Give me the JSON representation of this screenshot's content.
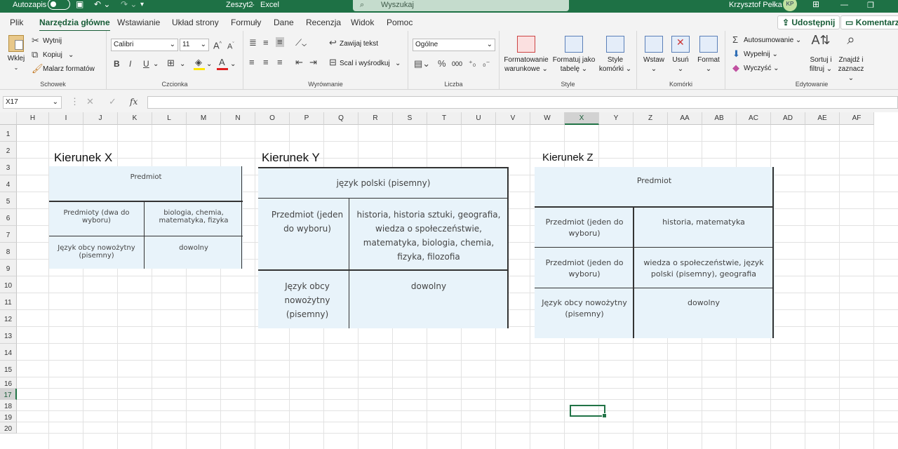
{
  "titlebar": {
    "autosave_label": "Autozapis",
    "filename": "Zeszyt2",
    "app": "Excel",
    "search_placeholder": "Wyszukaj",
    "user_name": "Krzysztof Pełka",
    "user_initials": "KP"
  },
  "tabs": [
    "Plik",
    "Narzędzia główne",
    "Wstawianie",
    "Układ strony",
    "Formuły",
    "Dane",
    "Recenzja",
    "Widok",
    "Pomoc"
  ],
  "share_label": "Udostępnij",
  "comments_label": "Komentarze",
  "ribbon": {
    "clipboard": {
      "paste": "Wklej",
      "cut": "Wytnij",
      "copy": "Kopiuj",
      "format_painter": "Malarz formatów",
      "label": "Schowek"
    },
    "font": {
      "name": "Calibri",
      "size": "11",
      "label": "Czcionka",
      "bold": "B",
      "italic": "I",
      "underline": "U",
      "grow": "A",
      "shrink": "A"
    },
    "alignment": {
      "wrap": "Zawijaj tekst",
      "merge": "Scal i wyśrodkuj",
      "label": "Wyrównanie"
    },
    "number": {
      "format": "Ogólne",
      "label": "Liczba",
      "percent": "%",
      "thousands": "000"
    },
    "styles": {
      "conditional": [
        "Formatowanie",
        "warunkowe"
      ],
      "table": [
        "Formatuj jako",
        "tabelę"
      ],
      "cell": [
        "Style",
        "komórki"
      ],
      "label": "Style"
    },
    "cells": {
      "insert": "Wstaw",
      "delete": "Usuń",
      "format": "Format",
      "label": "Komórki"
    },
    "editing": {
      "autosum": "Autosumowanie",
      "fill": "Wypełnij",
      "clear": "Wyczyść",
      "sort": [
        "Sortuj i",
        "filtruj"
      ],
      "find": [
        "Znajdź i",
        "zaznacz"
      ],
      "label": "Edytowanie"
    }
  },
  "formula_bar": {
    "name_box": "X17",
    "fx": "fx",
    "value": ""
  },
  "columns": [
    "H",
    "I",
    "J",
    "K",
    "L",
    "M",
    "N",
    "O",
    "P",
    "Q",
    "R",
    "S",
    "T",
    "U",
    "V",
    "W",
    "X",
    "Y",
    "Z",
    "AA",
    "AB",
    "AC",
    "AD",
    "AE",
    "AF"
  ],
  "rows": [
    "1",
    "2",
    "3",
    "4",
    "5",
    "6",
    "7",
    "8",
    "9",
    "10",
    "11",
    "12",
    "13",
    "14",
    "15",
    "16",
    "17",
    "18",
    "19",
    "20"
  ],
  "selected": {
    "column": "X",
    "row": "17"
  },
  "sheet": {
    "heading_x": "Kierunek X",
    "heading_y": "Kierunek Y",
    "heading_z": "Kierunek Z",
    "table_x": {
      "header": "Predmiot",
      "r1c1": "Predmioty (dwa do wyboru)",
      "r1c2": "biologia, chemia, matematyka, fizyka",
      "r2c1": "Język obcy nowożytny (pisemny)",
      "r2c2": "dowolny"
    },
    "table_y": {
      "header": "język polski (pisemny)",
      "r1c1": "Przedmiot (jeden do wyboru)",
      "r1c2": "historia, historia sztuki, geografia, wiedza o społeczeństwie, matematyka, biologia, chemia, fizyka, filozofia",
      "r2c1": "Język obcy nowożytny (pisemny)",
      "r2c2": "dowolny"
    },
    "table_z": {
      "header": "Predmiot",
      "r1c1": "Przedmiot (jeden do wyboru)",
      "r1c2": "historia, matematyka",
      "r2c1": "Przedmiot (jeden do wyboru)",
      "r2c2": "wiedza o społeczeństwie, język polski (pisemny), geografia",
      "r3c1": "Język obcy nowożytny (pisemny)",
      "r3c2": "dowolny"
    }
  }
}
